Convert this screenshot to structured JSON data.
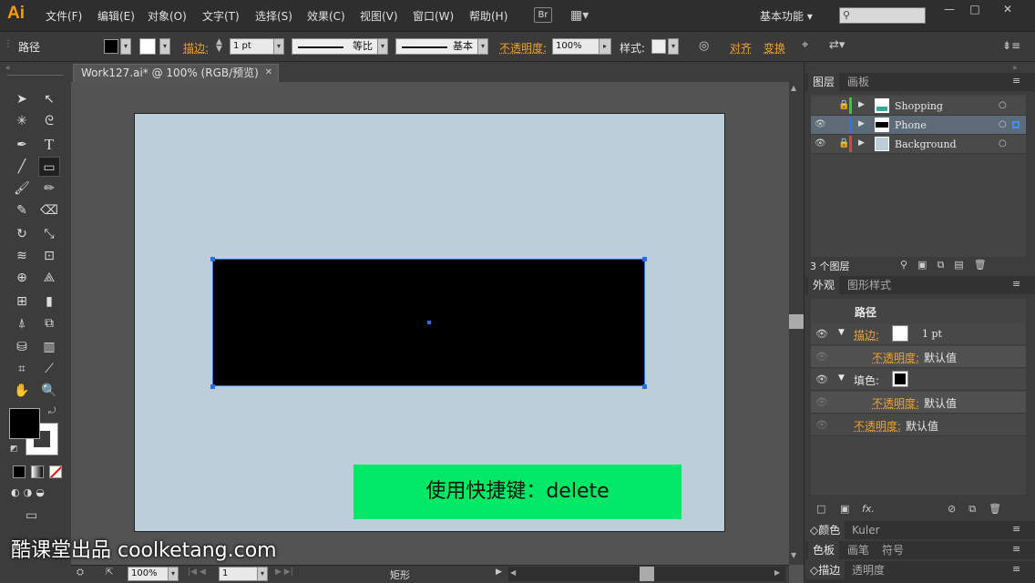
{
  "app_logo": "Ai",
  "menu": [
    "文件(F)",
    "编辑(E)",
    "对象(O)",
    "文字(T)",
    "选择(S)",
    "效果(C)",
    "视图(V)",
    "窗口(W)",
    "帮助(H)"
  ],
  "bridge_btn": "Br",
  "workspace": "基本功能",
  "window_controls": {
    "min": "—",
    "max": "□",
    "close": "✕"
  },
  "control": {
    "selection_type": "路径",
    "stroke_label": "描边:",
    "stroke_weight": "1 pt",
    "profile_uniform": "等比",
    "brush_basic": "基本",
    "opacity_label": "不透明度:",
    "opacity_value": "100%",
    "style_label": "样式:",
    "align_label": "对齐",
    "transform_label": "变换"
  },
  "document": {
    "tab_title": "Work127.ai* @ 100% (RGB/预览)",
    "tab_close": "✕"
  },
  "overlay": {
    "shortcut_text": "使用快捷键：delete",
    "watermark": "酷课堂出品 coolketang.com"
  },
  "status": {
    "zoom": "100%",
    "page": "1",
    "tool_name": "矩形"
  },
  "layers_panel": {
    "tabs": [
      "图层",
      "画板"
    ],
    "layers": [
      {
        "name": "Shopping",
        "color": "#2ecc40"
      },
      {
        "name": "Phone",
        "color": "#3b6fe0"
      },
      {
        "name": "Background",
        "color": "#e04040"
      }
    ],
    "count_text": "3 个图层"
  },
  "appearance_panel": {
    "tabs": [
      "外观",
      "图形样式"
    ],
    "title": "路径",
    "stroke_label": "描边:",
    "stroke_value": "1 pt",
    "opacity_label": "不透明度:",
    "opacity_value": "默认值",
    "fill_label": "填色:",
    "fx_label": "fx."
  },
  "bottom_panels": {
    "color_tabs": [
      "颜色",
      "Kuler"
    ],
    "swatch_tabs": [
      "色板",
      "画笔",
      "符号"
    ],
    "stroke_tabs": [
      "描边",
      "透明度"
    ]
  }
}
